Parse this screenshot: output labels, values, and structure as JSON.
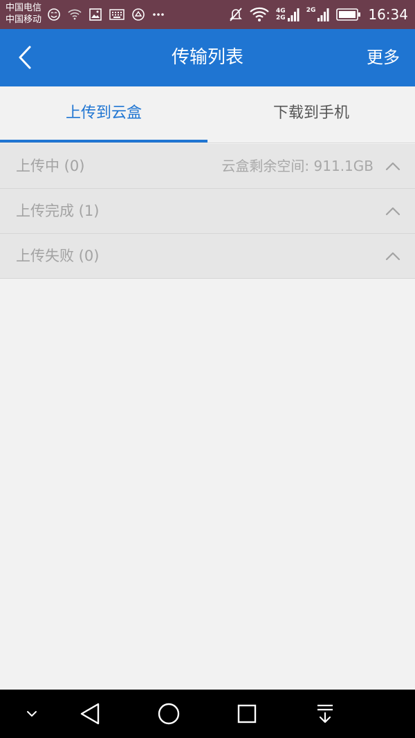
{
  "status_bar": {
    "carrier_1": "中国电信",
    "carrier_2": "中国移动",
    "net_1_top": "4G",
    "net_1_bottom": "2G",
    "net_2": "2G",
    "time": "16:34"
  },
  "app_bar": {
    "title": "传输列表",
    "more_label": "更多"
  },
  "tabs": [
    {
      "label": "上传到云盒",
      "active": true
    },
    {
      "label": "下载到手机",
      "active": false
    }
  ],
  "sections": [
    {
      "label": "上传中 (0)",
      "right_text": "云盒剩余空间: 911.1GB"
    },
    {
      "label": "上传完成 (1)",
      "right_text": ""
    },
    {
      "label": "上传失败 (0)",
      "right_text": ""
    }
  ],
  "colors": {
    "accent": "#1f75d2",
    "status_bar_bg": "#6b3d4c",
    "section_bg": "#e6e6e6",
    "content_bg": "#f2f2f2"
  }
}
